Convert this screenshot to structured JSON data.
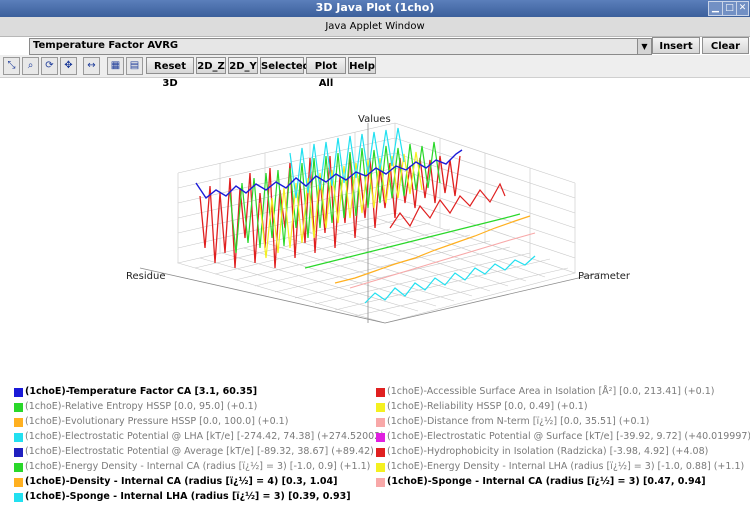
{
  "window": {
    "title": "3D Java Plot (1cho)",
    "applet_label": "Java Applet Window"
  },
  "selector": {
    "value": "Temperature Factor AVRG",
    "insert_label": "Insert",
    "clear_label": "Clear"
  },
  "toolbar": {
    "icons": [
      "zoom-fit-icon",
      "zoom-in-icon",
      "rotate-icon",
      "pan-icon",
      "move-icon",
      "table-icon",
      "grid-icon"
    ],
    "buttons": [
      "Reset 3D",
      "2D_Z",
      "2D_Y",
      "Selected",
      "Plot All",
      "Help"
    ]
  },
  "plot": {
    "axis_values": "Values",
    "axis_residue": "Residue",
    "axis_parameter": "Parameter"
  },
  "legend_left": [
    {
      "label": "(1choE)-Temperature Factor CA  [3.1, 60.35]",
      "color": "#1a1ad8",
      "active": true
    },
    {
      "label": "(1choE)-Relative Entropy HSSP  [0.0, 95.0] (+0.1)",
      "color": "#2ad82a",
      "active": false
    },
    {
      "label": "(1choE)-Evolutionary Pressure HSSP  [0.0, 100.0] (+0.1)",
      "color": "#ffb020",
      "active": false
    },
    {
      "label": "(1choE)-Electrostatic Potential @ LHA [kT/e]  [-274.42, 74.38] (+274.52002)",
      "color": "#22e0f0",
      "active": false
    },
    {
      "label": "(1choE)-Electrostatic Potential @ Average [kT/e]  [-89.32, 38.67] (+89.42)",
      "color": "#2020c0",
      "active": false
    },
    {
      "label": "(1choE)-Energy Density - Internal CA (radius [ï¿½] = 3)  [-1.0, 0.9] (+1.1)",
      "color": "#2ad82a",
      "active": false
    },
    {
      "label": "(1choE)-Density - Internal CA (radius [ï¿½] = 4)  [0.3, 1.04]",
      "color": "#ffb020",
      "active": true
    },
    {
      "label": "(1choE)-Sponge - Internal LHA (radius [ï¿½] = 3)  [0.39, 0.93]",
      "color": "#22e0f0",
      "active": true
    }
  ],
  "legend_right": [
    {
      "label": "(1choE)-Accessible Surface Area in Isolation [Å²]  [0.0, 213.41] (+0.1)",
      "color": "#e02020",
      "active": false
    },
    {
      "label": "(1choE)-Reliability HSSP  [0.0, 0.49] (+0.1)",
      "color": "#f4f020",
      "active": false
    },
    {
      "label": "(1choE)-Distance from N-term [ï¿½]  [0.0, 35.51] (+0.1)",
      "color": "#f8a8a8",
      "active": false
    },
    {
      "label": "(1choE)-Electrostatic Potential @ Surface [kT/e]  [-39.92, 9.72] (+40.019997)",
      "color": "#e020e0",
      "active": false
    },
    {
      "label": "(1choE)-Hydrophobicity in Isolation (Radzicka)  [-3.98, 4.92] (+4.08)",
      "color": "#e02020",
      "active": false
    },
    {
      "label": "(1choE)-Energy Density - Internal LHA (radius [ï¿½] = 3)  [-1.0, 0.88] (+1.1)",
      "color": "#f4f020",
      "active": false
    },
    {
      "label": "(1choE)-Sponge - Internal CA (radius [ï¿½] = 3)  [0.47, 0.94]",
      "color": "#f8a8a8",
      "active": true
    }
  ]
}
